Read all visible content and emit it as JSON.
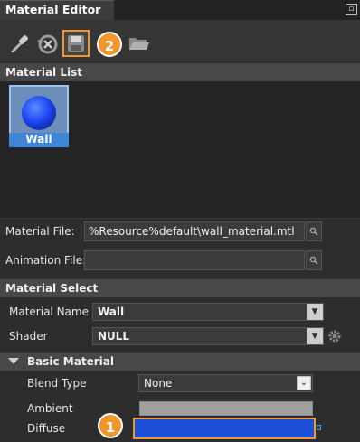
{
  "window": {
    "title": "Material Editor",
    "pin_glyph": "▫"
  },
  "toolbar": {
    "buttons": [
      {
        "icon": "eyedropper-icon"
      },
      {
        "icon": "reset-material-icon"
      },
      {
        "icon": "save-icon"
      },
      {
        "icon": "open-folder-icon"
      }
    ]
  },
  "annotations": {
    "badge_1": "1",
    "badge_2": "2"
  },
  "material_list": {
    "header": "Material List",
    "items": [
      {
        "label": "Wall",
        "selected": true
      }
    ]
  },
  "file_fields": {
    "material_file_label": "Material File:",
    "material_file_value": "%Resource%default\\wall_material.mtl",
    "animation_file_label": "Animation File:",
    "animation_file_value": ""
  },
  "material_select": {
    "header": "Material Select",
    "name_label": "Material Name",
    "name_value": "Wall",
    "shader_label": "Shader",
    "shader_value": "NULL"
  },
  "basic_material": {
    "header": "Basic Material",
    "blend_type_label": "Blend Type",
    "blend_type_value": "None",
    "ambient_label": "Ambient",
    "diffuse_label": "Diffuse"
  },
  "colors": {
    "accent_highlight": "#f0962a",
    "diffuse_color": "#1e4fd8",
    "ambient_color": "#a0a0a0",
    "selection_blue": "#3f86d8"
  }
}
